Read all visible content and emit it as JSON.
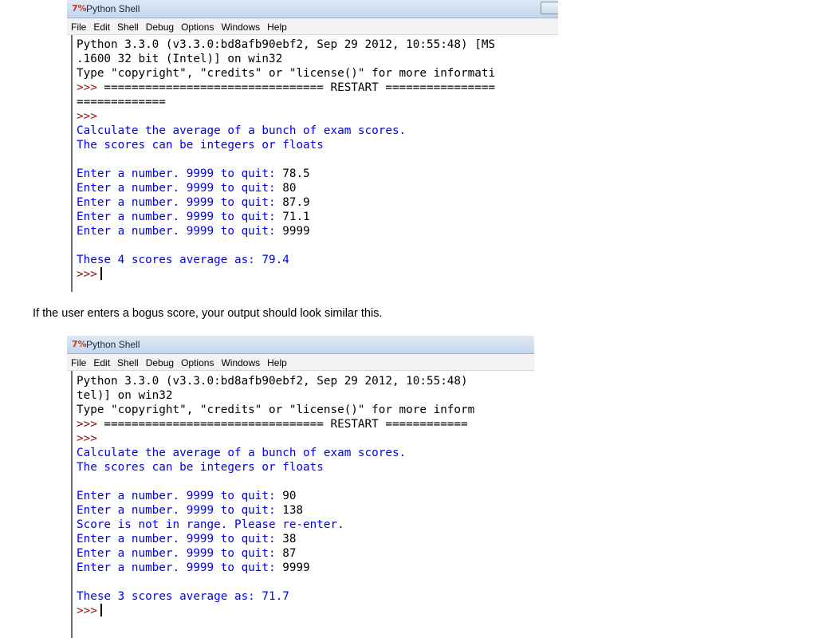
{
  "window1": {
    "title": "Python Shell",
    "menu": [
      "File",
      "Edit",
      "Shell",
      "Debug",
      "Options",
      "Windows",
      "Help"
    ],
    "lines": [
      {
        "text": "Python 3.3.0 (v3.3.0:bd8afb90ebf2, Sep 29 2012, 10:55:48) [MS",
        "style": "black"
      },
      {
        "text": ".1600 32 bit (Intel)] on win32",
        "style": "black"
      },
      {
        "text": "Type \"copyright\", \"credits\" or \"license()\" for more informati",
        "style": "black"
      },
      {
        "text": ">>> ================================ RESTART ================",
        "style": "black"
      },
      {
        "text": "=============",
        "style": "black"
      },
      {
        "text": ">>>",
        "style": "maroon"
      },
      {
        "text": "Calculate the average of a bunch of exam scores.",
        "style": "blue"
      },
      {
        "text": "The scores can be integers or floats",
        "style": "blue"
      },
      {
        "text": "",
        "style": "blue"
      },
      {
        "text": "Enter a number. 9999 to quit: 78.5",
        "style": "blue",
        "input": "78.5"
      },
      {
        "text": "Enter a number. 9999 to quit: 80",
        "style": "blue",
        "input": "80"
      },
      {
        "text": "Enter a number. 9999 to quit: 87.9",
        "style": "blue",
        "input": "87.9"
      },
      {
        "text": "Enter a number. 9999 to quit: 71.1",
        "style": "blue",
        "input": "71.1"
      },
      {
        "text": "Enter a number. 9999 to quit: 9999",
        "style": "blue",
        "input": "9999"
      },
      {
        "text": "",
        "style": "blue"
      },
      {
        "text": "These 4 scores average as: 79.4",
        "style": "blue"
      },
      {
        "text": ">>>",
        "style": "maroon",
        "cursor": true
      }
    ]
  },
  "caption": "If the user enters a bogus score, your output should look similar this.",
  "window2": {
    "title": "Python Shell",
    "menu": [
      "File",
      "Edit",
      "Shell",
      "Debug",
      "Options",
      "Windows",
      "Help"
    ],
    "lines": [
      {
        "text": "Python 3.3.0 (v3.3.0:bd8afb90ebf2, Sep 29 2012, 10:55:48)",
        "style": "black"
      },
      {
        "text": "tel)] on win32",
        "style": "black"
      },
      {
        "text": "Type \"copyright\", \"credits\" or \"license()\" for more inform",
        "style": "black"
      },
      {
        "text": ">>> ================================ RESTART ============",
        "style": "black"
      },
      {
        "text": ">>>",
        "style": "maroon"
      },
      {
        "text": "Calculate the average of a bunch of exam scores.",
        "style": "blue"
      },
      {
        "text": "The scores can be integers or floats",
        "style": "blue"
      },
      {
        "text": "",
        "style": "blue"
      },
      {
        "text": "Enter a number. 9999 to quit: 90",
        "style": "blue",
        "input": "90"
      },
      {
        "text": "Enter a number. 9999 to quit: 138",
        "style": "blue",
        "input": "138"
      },
      {
        "text": "Score is not in range. Please re-enter.",
        "style": "blue"
      },
      {
        "text": "Enter a number. 9999 to quit: 38",
        "style": "blue",
        "input": "38"
      },
      {
        "text": "Enter a number. 9999 to quit: 87",
        "style": "blue",
        "input": "87"
      },
      {
        "text": "Enter a number. 9999 to quit: 9999",
        "style": "blue",
        "input": "9999"
      },
      {
        "text": "",
        "style": "blue"
      },
      {
        "text": "These 3 scores average as: 71.7",
        "style": "blue"
      },
      {
        "text": ">>>",
        "style": "maroon",
        "cursor": true
      }
    ]
  },
  "colors": {
    "stdout": "#0000ee",
    "prompt": "#8a0e0e",
    "input": "#000000"
  }
}
